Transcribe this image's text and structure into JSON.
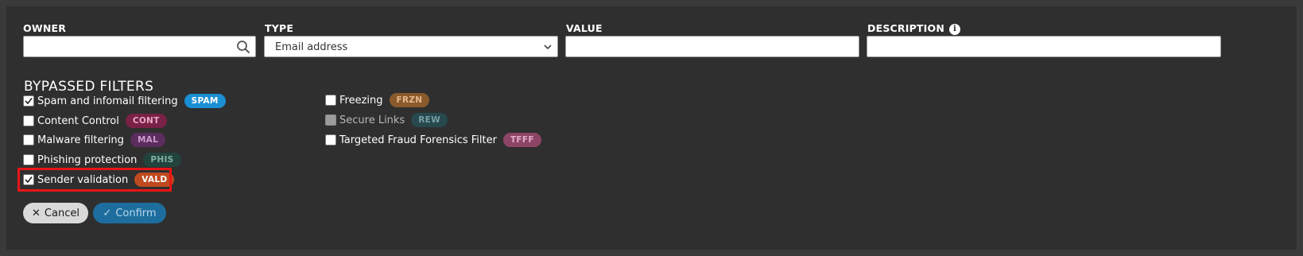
{
  "form": {
    "owner_label": "OWNER",
    "owner_value": "",
    "type_label": "TYPE",
    "type_value": "Email address",
    "value_label": "VALUE",
    "value_value": "",
    "description_label": "DESCRIPTION",
    "description_value": "",
    "info_glyph": "i"
  },
  "filters": {
    "title": "BYPASSED FILTERS",
    "items": [
      {
        "label": "Spam and infomail filtering",
        "badge": "SPAM",
        "checked": true,
        "disabled": false,
        "badge_bg": "#1a8fd3",
        "badge_fg": "#ffffff"
      },
      {
        "label": "Content Control",
        "badge": "CONT",
        "checked": false,
        "disabled": false,
        "badge_bg": "#7a2147",
        "badge_fg": "#e8a8c3"
      },
      {
        "label": "Malware filtering",
        "badge": "MAL",
        "checked": false,
        "disabled": false,
        "badge_bg": "#5b2d5e",
        "badge_fg": "#c99ccc"
      },
      {
        "label": "Phishing protection",
        "badge": "PHIS",
        "checked": false,
        "disabled": false,
        "badge_bg": "#23443d",
        "badge_fg": "#7fb0a4"
      },
      {
        "label": "Sender validation",
        "badge": "VALD",
        "checked": true,
        "disabled": false,
        "badge_bg": "#bf4a1f",
        "badge_fg": "#ffffff"
      },
      {
        "label": "Freezing",
        "badge": "FRZN",
        "checked": false,
        "disabled": false,
        "badge_bg": "#8a5a2c",
        "badge_fg": "#e3b98b"
      },
      {
        "label": "Secure Links",
        "badge": "REW",
        "checked": false,
        "disabled": true,
        "badge_bg": "#27484d",
        "badge_fg": "#77a0a4"
      },
      {
        "label": "Targeted Fraud Forensics Filter",
        "badge": "TFFF",
        "checked": false,
        "disabled": false,
        "badge_bg": "#8d4566",
        "badge_fg": "#e2aec6"
      }
    ]
  },
  "actions": {
    "cancel_label": "Cancel",
    "cancel_icon": "close-icon",
    "confirm_label": "Confirm",
    "confirm_icon": "check-icon"
  },
  "colors": {
    "panel_bg": "#2f2f2f",
    "highlight": "#e81515",
    "confirm_bg": "#1d6e9e"
  }
}
